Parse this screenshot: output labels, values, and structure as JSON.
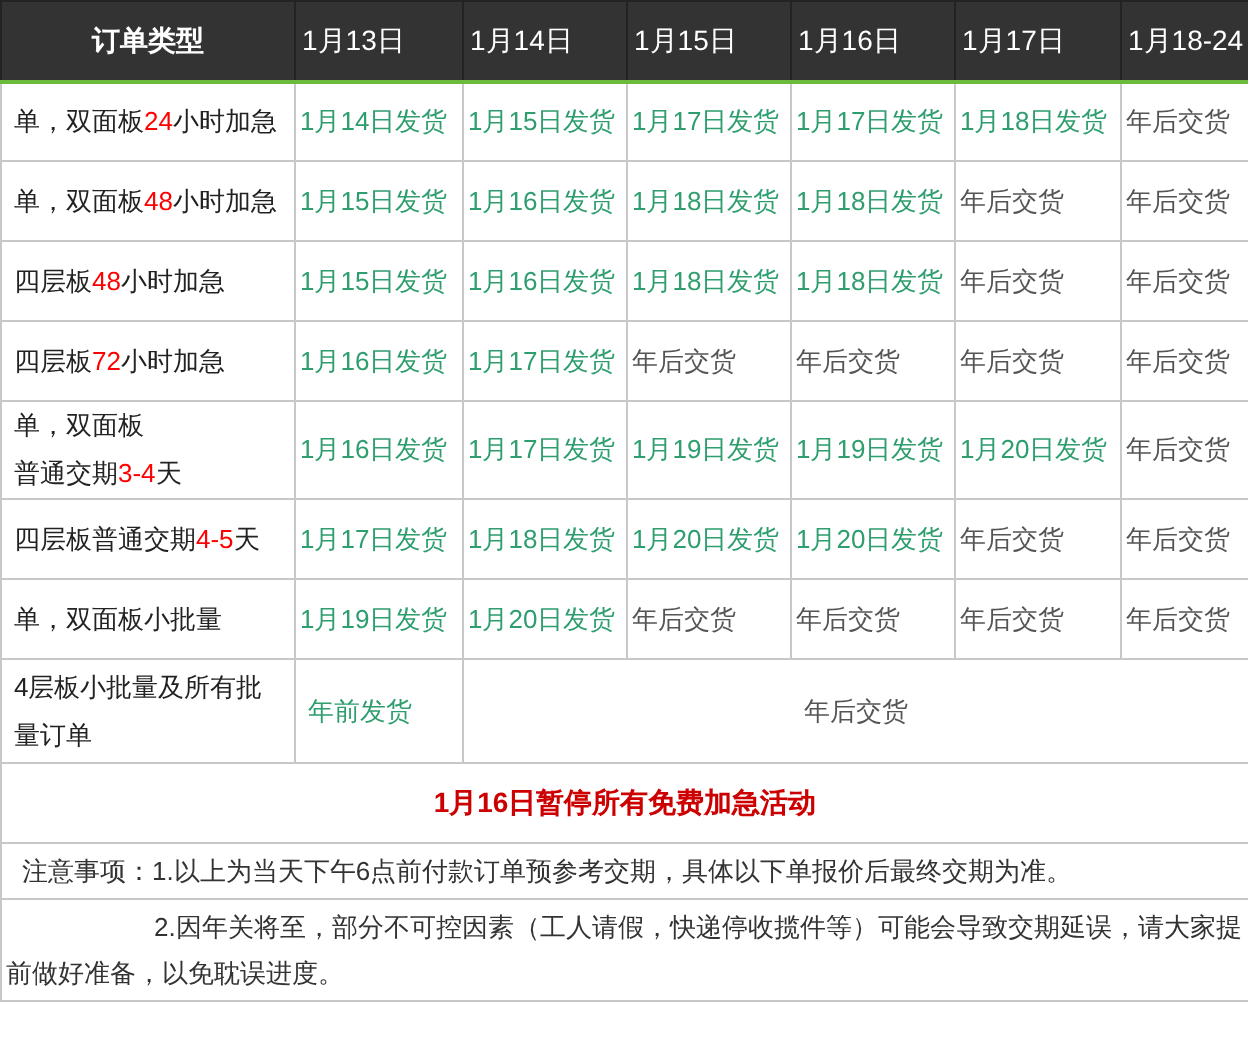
{
  "table": {
    "columns": [
      "订单类型",
      "1月13日",
      "1月14日",
      "1月15日",
      "1月16日",
      "1月17日",
      "1月18-24"
    ],
    "rows": [
      {
        "cells": [
          {
            "kind": "label",
            "parts": [
              {
                "text": "单，双面板",
                "highlight": false
              },
              {
                "text": "24",
                "highlight": true
              },
              {
                "text": "小时加急",
                "highlight": false
              }
            ]
          },
          {
            "text": "1月14日发货",
            "kind": "ship"
          },
          {
            "text": "1月15日发货",
            "kind": "ship"
          },
          {
            "text": "1月17日发货",
            "kind": "ship"
          },
          {
            "text": "1月17日发货",
            "kind": "ship"
          },
          {
            "text": "1月18日发货",
            "kind": "ship"
          },
          {
            "text": "年后交货",
            "kind": "after"
          }
        ]
      },
      {
        "cells": [
          {
            "kind": "label",
            "parts": [
              {
                "text": "单，双面板",
                "highlight": false
              },
              {
                "text": "48",
                "highlight": true
              },
              {
                "text": "小时加急",
                "highlight": false
              }
            ]
          },
          {
            "text": "1月15日发货",
            "kind": "ship"
          },
          {
            "text": "1月16日发货",
            "kind": "ship"
          },
          {
            "text": "1月18日发货",
            "kind": "ship"
          },
          {
            "text": "1月18日发货",
            "kind": "ship"
          },
          {
            "text": "年后交货",
            "kind": "after"
          },
          {
            "text": "年后交货",
            "kind": "after"
          }
        ]
      },
      {
        "cells": [
          {
            "kind": "label",
            "parts": [
              {
                "text": "四层板",
                "highlight": false
              },
              {
                "text": "48",
                "highlight": true
              },
              {
                "text": "小时加急",
                "highlight": false
              }
            ]
          },
          {
            "text": "1月15日发货",
            "kind": "ship"
          },
          {
            "text": "1月16日发货",
            "kind": "ship"
          },
          {
            "text": "1月18日发货",
            "kind": "ship"
          },
          {
            "text": "1月18日发货",
            "kind": "ship"
          },
          {
            "text": "年后交货",
            "kind": "after"
          },
          {
            "text": "年后交货",
            "kind": "after"
          }
        ]
      },
      {
        "cells": [
          {
            "kind": "label",
            "parts": [
              {
                "text": "四层板",
                "highlight": false
              },
              {
                "text": "72",
                "highlight": true
              },
              {
                "text": "小时加急",
                "highlight": false
              }
            ]
          },
          {
            "text": "1月16日发货",
            "kind": "ship"
          },
          {
            "text": "1月17日发货",
            "kind": "ship"
          },
          {
            "text": "年后交货",
            "kind": "after"
          },
          {
            "text": "年后交货",
            "kind": "after"
          },
          {
            "text": "年后交货",
            "kind": "after"
          },
          {
            "text": "年后交货",
            "kind": "after"
          }
        ]
      },
      {
        "cells": [
          {
            "kind": "label",
            "parts": [
              {
                "text": "单，双面板",
                "highlight": false
              }
            ],
            "second_line": [
              {
                "text": "普通交期",
                "highlight": false
              },
              {
                "text": "3-4",
                "highlight": true
              },
              {
                "text": "天",
                "highlight": false
              }
            ]
          },
          {
            "text": "1月16日发货",
            "kind": "ship"
          },
          {
            "text": "1月17日发货",
            "kind": "ship"
          },
          {
            "text": "1月19日发货",
            "kind": "ship"
          },
          {
            "text": "1月19日发货",
            "kind": "ship"
          },
          {
            "text": "1月20日发货",
            "kind": "ship"
          },
          {
            "text": "年后交货",
            "kind": "after"
          }
        ]
      },
      {
        "cells": [
          {
            "kind": "label",
            "parts": [
              {
                "text": "四层板普通交期",
                "highlight": false
              },
              {
                "text": "4-5",
                "highlight": true
              },
              {
                "text": "天",
                "highlight": false
              }
            ]
          },
          {
            "text": "1月17日发货",
            "kind": "ship"
          },
          {
            "text": "1月18日发货",
            "kind": "ship"
          },
          {
            "text": "1月20日发货",
            "kind": "ship"
          },
          {
            "text": "1月20日发货",
            "kind": "ship"
          },
          {
            "text": "年后交货",
            "kind": "after"
          },
          {
            "text": "年后交货",
            "kind": "after"
          }
        ]
      },
      {
        "cells": [
          {
            "kind": "label",
            "parts": [
              {
                "text": "单，双面板小批量",
                "highlight": false
              }
            ]
          },
          {
            "text": "1月19日发货",
            "kind": "ship"
          },
          {
            "text": "1月20日发货",
            "kind": "ship"
          },
          {
            "text": "年后交货",
            "kind": "after"
          },
          {
            "text": "年后交货",
            "kind": "after"
          },
          {
            "text": "年后交货",
            "kind": "after"
          },
          {
            "text": "年后交货",
            "kind": "after"
          }
        ]
      },
      {
        "cells": [
          {
            "kind": "label",
            "parts": [
              {
                "text": "4层板小批量及所有批量订单",
                "highlight": false
              }
            ]
          },
          {
            "text": "年前发货",
            "kind": "ship"
          },
          {
            "text": "年后交货",
            "kind": "after_merged",
            "colspan": 5
          }
        ]
      }
    ]
  },
  "banner": "1月16日暂停所有免费加急活动",
  "notes": [
    "注意事项：1.以上为当天下午6点前付款订单预参考交期，具体以下单报价后最终交期为准。",
    "2.因年关将至，部分不可控因素（工人请假，快递停收揽件等）可能会导致交期延误，请大家提前做好准备，以免耽误进度。"
  ]
}
